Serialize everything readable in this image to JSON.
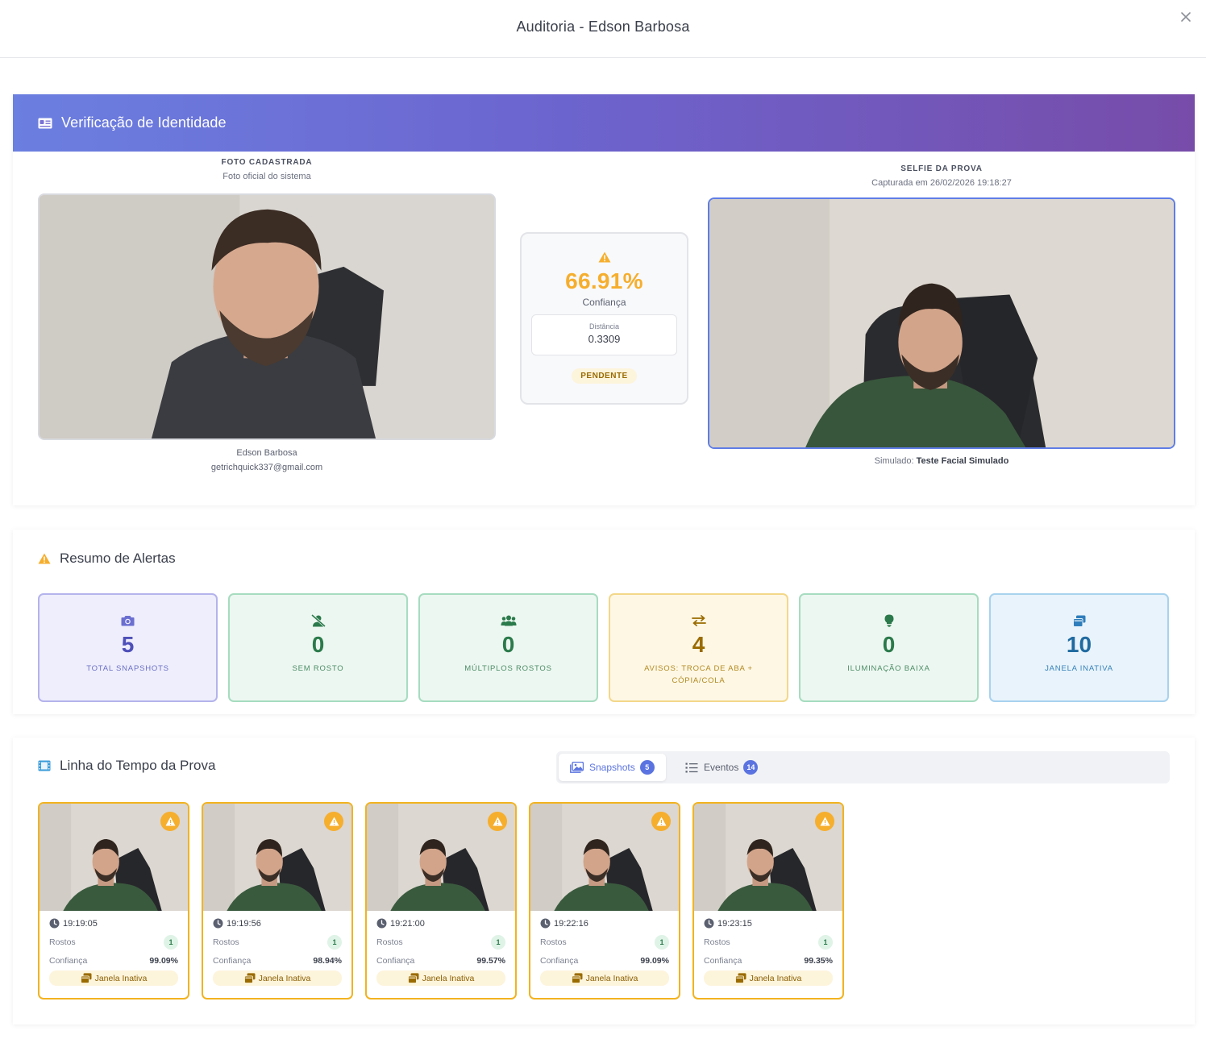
{
  "modal": {
    "title": "Auditoria - Edson Barbosa",
    "close_label": "×"
  },
  "identity": {
    "header": "Verificação de Identidade",
    "registered": {
      "title": "FOTO CADASTRADA",
      "subtitle": "Foto oficial do sistema",
      "name": "Edson Barbosa",
      "email": "getrichquick337@gmail.com"
    },
    "selfie": {
      "title": "SELFIE DA PROVA",
      "subtitle": "Capturada em 26/02/2026 19:18:27",
      "sim_prefix": "Simulado:",
      "sim_name": "Teste Facial Simulado"
    },
    "score": {
      "confidence": "66.91%",
      "confidence_label": "Confiança",
      "distance_label": "Distância",
      "distance": "0.3309",
      "status": "PENDENTE"
    }
  },
  "alerts": {
    "title": "Resumo de Alertas",
    "items": [
      {
        "value": "5",
        "label": "TOTAL SNAPSHOTS",
        "icon": "camera-icon"
      },
      {
        "value": "0",
        "label": "SEM ROSTO",
        "icon": "no-face-icon"
      },
      {
        "value": "0",
        "label": "MÚLTIPLOS ROSTOS",
        "icon": "users-icon"
      },
      {
        "value": "4",
        "label": "AVISOS: TROCA DE ABA + CÓPIA/COLA",
        "icon": "swap-icon"
      },
      {
        "value": "0",
        "label": "ILUMINAÇÃO BAIXA",
        "icon": "lightbulb-icon"
      },
      {
        "value": "10",
        "label": "JANELA INATIVA",
        "icon": "windows-icon"
      }
    ]
  },
  "timeline": {
    "title": "Linha do Tempo da Prova",
    "tabs": [
      {
        "label": "Snapshots",
        "count": "5",
        "active": true
      },
      {
        "label": "Eventos",
        "count": "14",
        "active": false
      }
    ],
    "snapshot_faces_label": "Rostos",
    "snapshot_conf_label": "Confiança",
    "snapshots": [
      {
        "time": "19:19:05",
        "faces": "1",
        "confidence": "99.09%",
        "tag": "Janela Inativa"
      },
      {
        "time": "19:19:56",
        "faces": "1",
        "confidence": "98.94%",
        "tag": "Janela Inativa"
      },
      {
        "time": "19:21:00",
        "faces": "1",
        "confidence": "99.57%",
        "tag": "Janela Inativa"
      },
      {
        "time": "19:22:16",
        "faces": "1",
        "confidence": "99.09%",
        "tag": "Janela Inativa"
      },
      {
        "time": "19:23:15",
        "faces": "1",
        "confidence": "99.35%",
        "tag": "Janela Inativa"
      }
    ]
  },
  "colors": {
    "accent": "#5a73e0",
    "warning": "#f6ae2d",
    "gradient_start": "#6b7fe0",
    "gradient_end": "#774ca9"
  }
}
